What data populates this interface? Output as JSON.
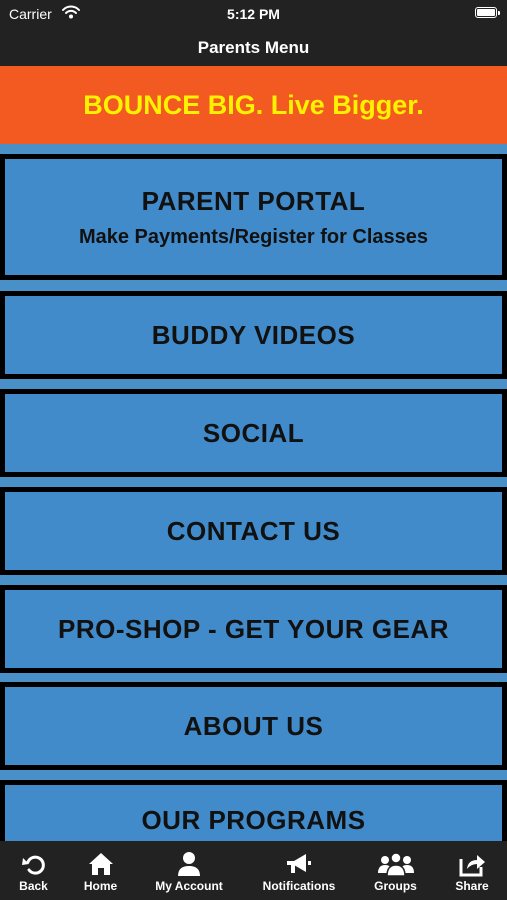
{
  "status_bar": {
    "carrier": "Carrier",
    "time": "5:12 PM"
  },
  "nav_bar": {
    "title": "Parents Menu"
  },
  "banner": {
    "text": "BOUNCE BIG. Live Bigger."
  },
  "menu": {
    "items": [
      {
        "title": "PARENT PORTAL",
        "subtitle": "Make Payments/Register for Classes"
      },
      {
        "title": "BUDDY VIDEOS"
      },
      {
        "title": "SOCIAL"
      },
      {
        "title": "CONTACT US"
      },
      {
        "title": "PRO-SHOP - GET YOUR GEAR"
      },
      {
        "title": "ABOUT US"
      },
      {
        "title": "OUR PROGRAMS"
      }
    ]
  },
  "tab_bar": {
    "tabs": [
      {
        "label": "Back",
        "icon": "back-icon"
      },
      {
        "label": "Home",
        "icon": "home-icon"
      },
      {
        "label": "My Account",
        "icon": "user-icon"
      },
      {
        "label": "Notifications",
        "icon": "megaphone-icon"
      },
      {
        "label": "Groups",
        "icon": "groups-icon"
      },
      {
        "label": "Share",
        "icon": "share-icon"
      }
    ]
  },
  "colors": {
    "banner_bg": "#f25a21",
    "banner_text": "#fff200",
    "menu_item_bg": "#418bca",
    "menu_border": "#000000",
    "bar_bg": "#222222"
  }
}
